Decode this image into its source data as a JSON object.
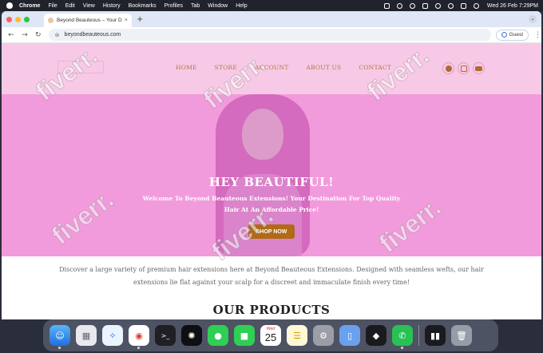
{
  "menubar": {
    "app_name": "Chrome",
    "menus": [
      "File",
      "Edit",
      "View",
      "History",
      "Bookmarks",
      "Profiles",
      "Tab",
      "Window",
      "Help"
    ],
    "clock": "Wed 26 Feb  7:29PM"
  },
  "browser": {
    "tab_title": "Beyond Beauteous – Your De",
    "tab_close": "×",
    "new_tab": "+",
    "url": "beyondbeauteous.com",
    "profile_label": "Guest",
    "traffic_lights": {
      "close": "#ff5f57",
      "minimize": "#febc2e",
      "maximize": "#28c840"
    }
  },
  "site": {
    "nav": [
      "HOME",
      "STORE",
      "ACCOUNT",
      "ABOUT US",
      "CONTACT"
    ],
    "social": [
      "facebook-icon",
      "instagram-icon",
      "youtube-icon"
    ],
    "hero": {
      "title": "HEY BEAUTIFUL!",
      "subtitle": "Welcome To Beyond Beauteous Extensions! Your Destination For Top Quality Hair At An Affordable Price!",
      "cta": "SHOP NOW"
    },
    "intro": "Discover a large variety of premium hair extensions here at Beyond Beauteous Extensions. Designed with seamless wefts, our hair extensions lie flat against your scalp for a discreet and immaculate finish every time!",
    "products_heading": "OUR PRODUCTS",
    "colors": {
      "header_bg": "#f8c9e6",
      "hero_bg": "#f29bdc",
      "accent": "#b07a47",
      "button": "#b06a18"
    }
  },
  "watermark": {
    "text": "fiverr."
  },
  "dock": {
    "calendar": {
      "month": "Wed",
      "day": "25"
    },
    "apps": [
      "finder-icon",
      "launchpad-icon",
      "safari-icon",
      "chrome-icon",
      "terminal-icon",
      "chatgpt-icon",
      "messages-icon",
      "facetime-icon",
      "calendar-icon",
      "notes-icon",
      "system-settings-icon",
      "simulator-icon",
      "cursor-icon",
      "whatsapp-icon",
      "audio-icon",
      "trash-icon"
    ]
  }
}
